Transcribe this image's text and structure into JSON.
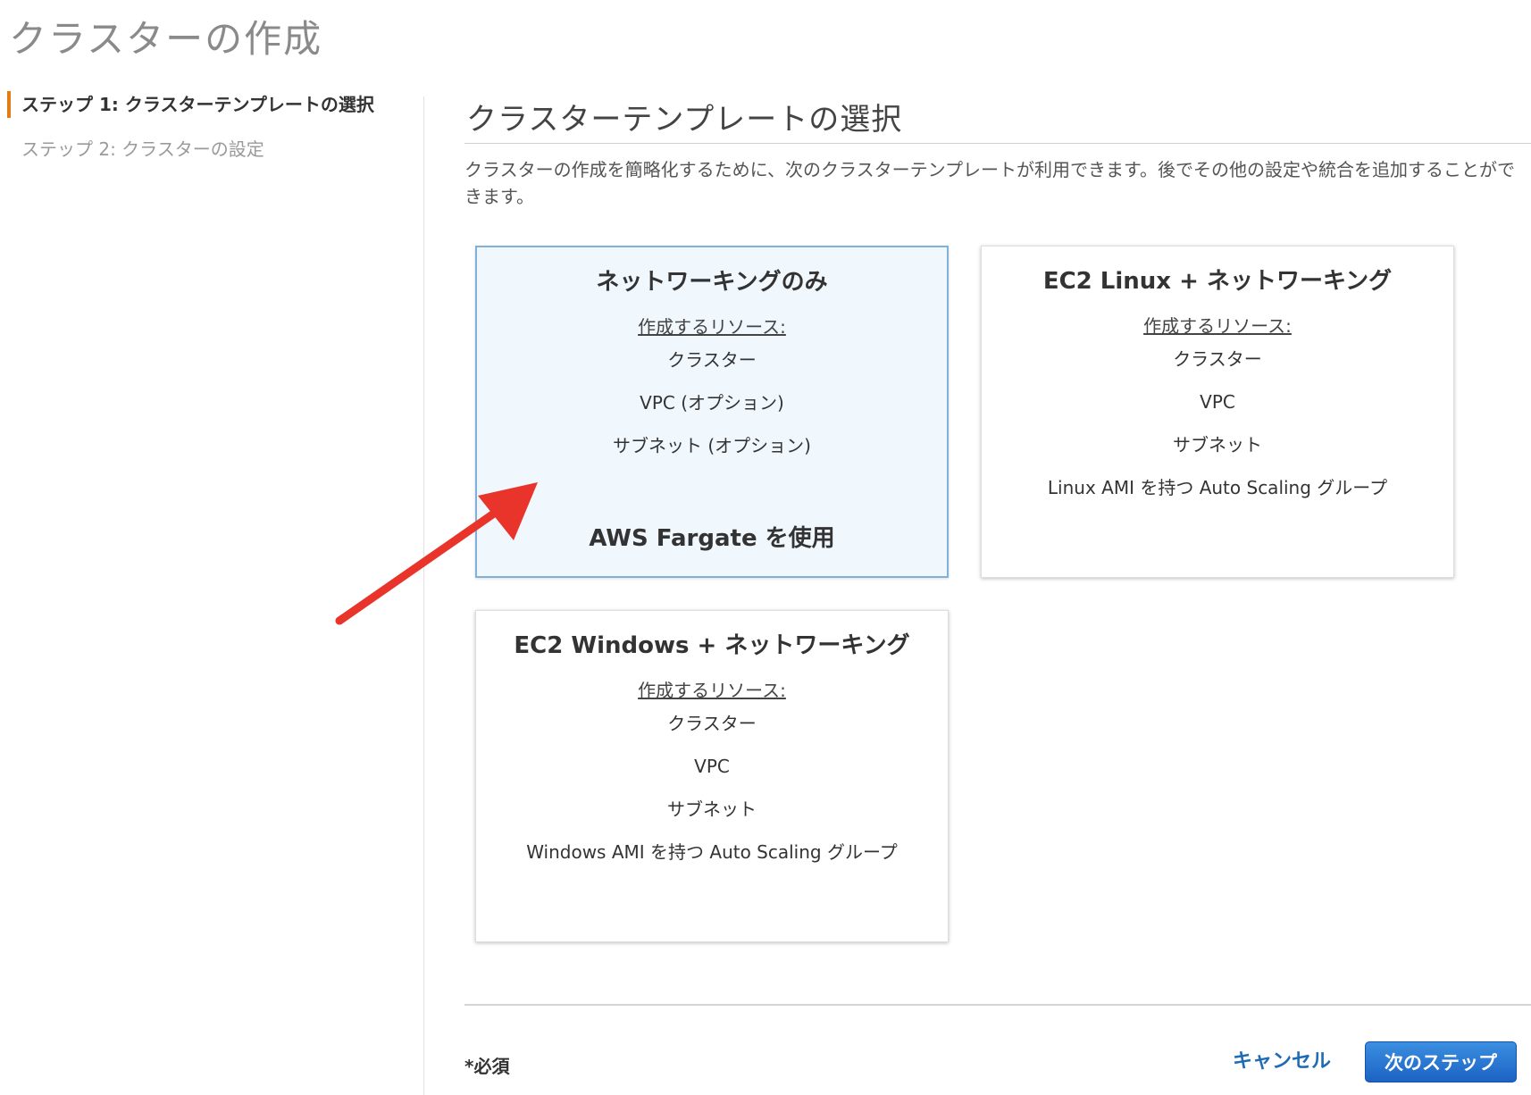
{
  "page_title": "クラスターの作成",
  "sidebar": {
    "steps": [
      {
        "label": "ステップ 1: クラスターテンプレートの選択",
        "active": true
      },
      {
        "label": "ステップ 2: クラスターの設定",
        "active": false
      }
    ]
  },
  "main": {
    "section_title": "クラスターテンプレートの選択",
    "description": "クラスターの作成を簡略化するために、次のクラスターテンプレートが利用できます。後でその他の設定や統合を追加することができます。",
    "cards": [
      {
        "title": "ネットワーキングのみ",
        "resources_label": "作成するリソース:",
        "items": [
          "クラスター",
          "VPC (オプション)",
          "サブネット (オプション)"
        ],
        "footer": "AWS Fargate を使用",
        "selected": true
      },
      {
        "title": "EC2 Linux + ネットワーキング",
        "resources_label": "作成するリソース:",
        "items": [
          "クラスター",
          "VPC",
          "サブネット",
          "Linux AMI を持つ Auto Scaling グループ"
        ],
        "selected": false
      },
      {
        "title": "EC2 Windows + ネットワーキング",
        "resources_label": "作成するリソース:",
        "items": [
          "クラスター",
          "VPC",
          "サブネット",
          "Windows AMI を持つ Auto Scaling グループ"
        ],
        "selected": false
      }
    ]
  },
  "footer": {
    "required_label": "*必須",
    "cancel_label": "キャンセル",
    "next_label": "次のステップ"
  },
  "colors": {
    "accent_step": "#e37c12",
    "selected_card_bg": "#f0f7fd",
    "selected_card_border": "#7fb1d9",
    "link_blue": "#1f6cb5",
    "primary_button": "#1c63c4",
    "annotation_arrow": "#e8342a"
  },
  "icons": {
    "annotation": "red-arrow-icon"
  }
}
